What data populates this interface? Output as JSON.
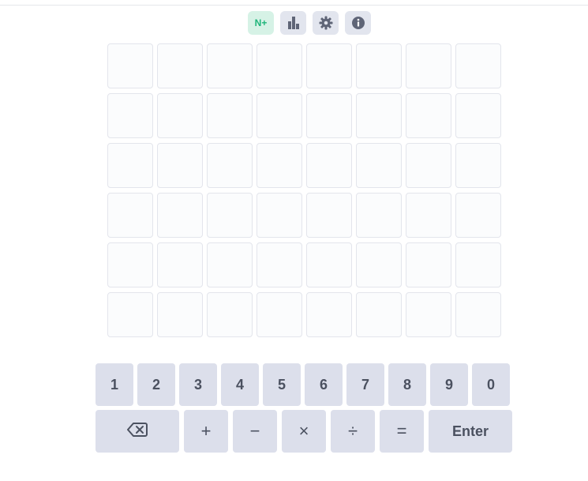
{
  "toolbar": {
    "nplus_label": "N+",
    "buttons": [
      {
        "name": "nplus-button",
        "icon": "n-plus"
      },
      {
        "name": "stats-button",
        "icon": "bar-chart-icon"
      },
      {
        "name": "settings-button",
        "icon": "gear-icon"
      },
      {
        "name": "info-button",
        "icon": "info-icon"
      }
    ]
  },
  "board": {
    "rows": 6,
    "columns": 8,
    "cells": [
      [
        "",
        "",
        "",
        "",
        "",
        "",
        "",
        ""
      ],
      [
        "",
        "",
        "",
        "",
        "",
        "",
        "",
        ""
      ],
      [
        "",
        "",
        "",
        "",
        "",
        "",
        "",
        ""
      ],
      [
        "",
        "",
        "",
        "",
        "",
        "",
        "",
        ""
      ],
      [
        "",
        "",
        "",
        "",
        "",
        "",
        "",
        ""
      ],
      [
        "",
        "",
        "",
        "",
        "",
        "",
        "",
        ""
      ]
    ]
  },
  "keyboard": {
    "digits": [
      "1",
      "2",
      "3",
      "4",
      "5",
      "6",
      "7",
      "8",
      "9",
      "0"
    ],
    "operators": [
      {
        "name": "plus-key",
        "label": "+"
      },
      {
        "name": "minus-key",
        "label": "−"
      },
      {
        "name": "multiply-key",
        "label": "×"
      },
      {
        "name": "divide-key",
        "label": "÷"
      },
      {
        "name": "equals-key",
        "label": "="
      }
    ],
    "enter_label": "Enter",
    "backspace_icon": "backspace-icon"
  },
  "colors": {
    "key_bg": "#dcdfeb",
    "key_text": "#4b5160",
    "cell_border": "#e3e5ec",
    "nplus_bg": "#d6f2e6",
    "nplus_text": "#1fb57a",
    "icon_color": "#5f6577"
  }
}
